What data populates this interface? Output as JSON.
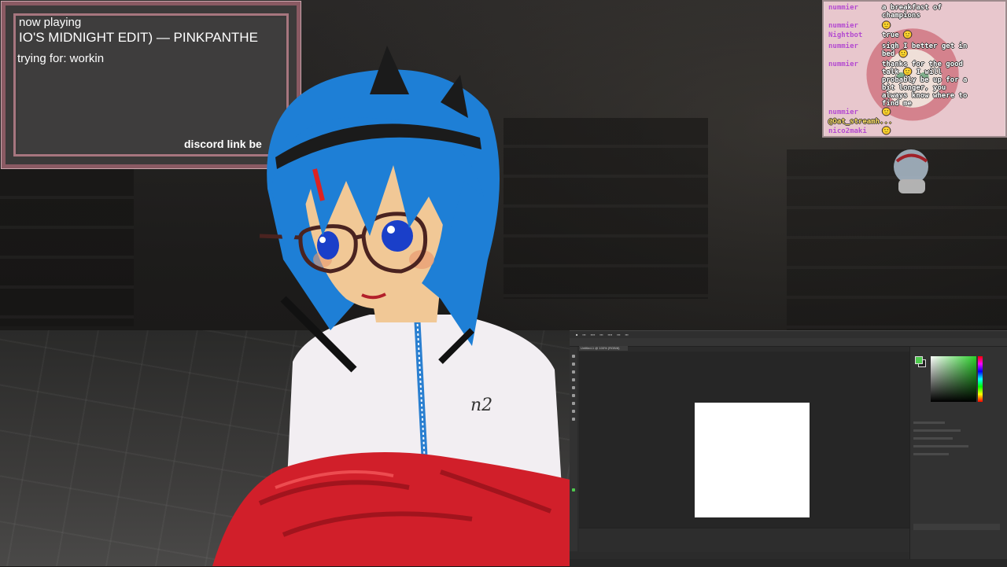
{
  "now_playing": {
    "label": "now playing",
    "track": "IO'S MIDNIGHT EDIT) — PINKPANTHE",
    "trying_for": "trying for: workin",
    "discord": "discord link be"
  },
  "chat": {
    "messages": [
      {
        "user": "nummier",
        "text": "a breakfast of\nchampions"
      },
      {
        "user": "nummier",
        "text": "🙂"
      },
      {
        "user": "Nightbot",
        "text": "true 🙂"
      },
      {
        "user": "nummier",
        "text": "sigh I better get in\nbed 🙂"
      },
      {
        "user": "nummier",
        "text": "thanks for the good\ntalk 🙂 I will\nprobably be up for a\nbit longer, you\nalways know where to\nfind me"
      },
      {
        "user": "nummier",
        "text": "🙂"
      },
      {
        "user": "",
        "text": "@Oat_streamh..."
      },
      {
        "user": "nico2maki",
        "text": "🙂"
      }
    ],
    "user_color": "#b44bd0"
  },
  "photoshop": {
    "tab": "Untitled-1 @ 100% (RGB/8)",
    "canvas_color": "#ffffff",
    "foreground_color": "#4ec94e"
  },
  "colors": {
    "panel_border": "#8a5a63",
    "hair": "#1e7fd6",
    "jacket": "#f2eef2",
    "blanket": "#d11f2a"
  }
}
